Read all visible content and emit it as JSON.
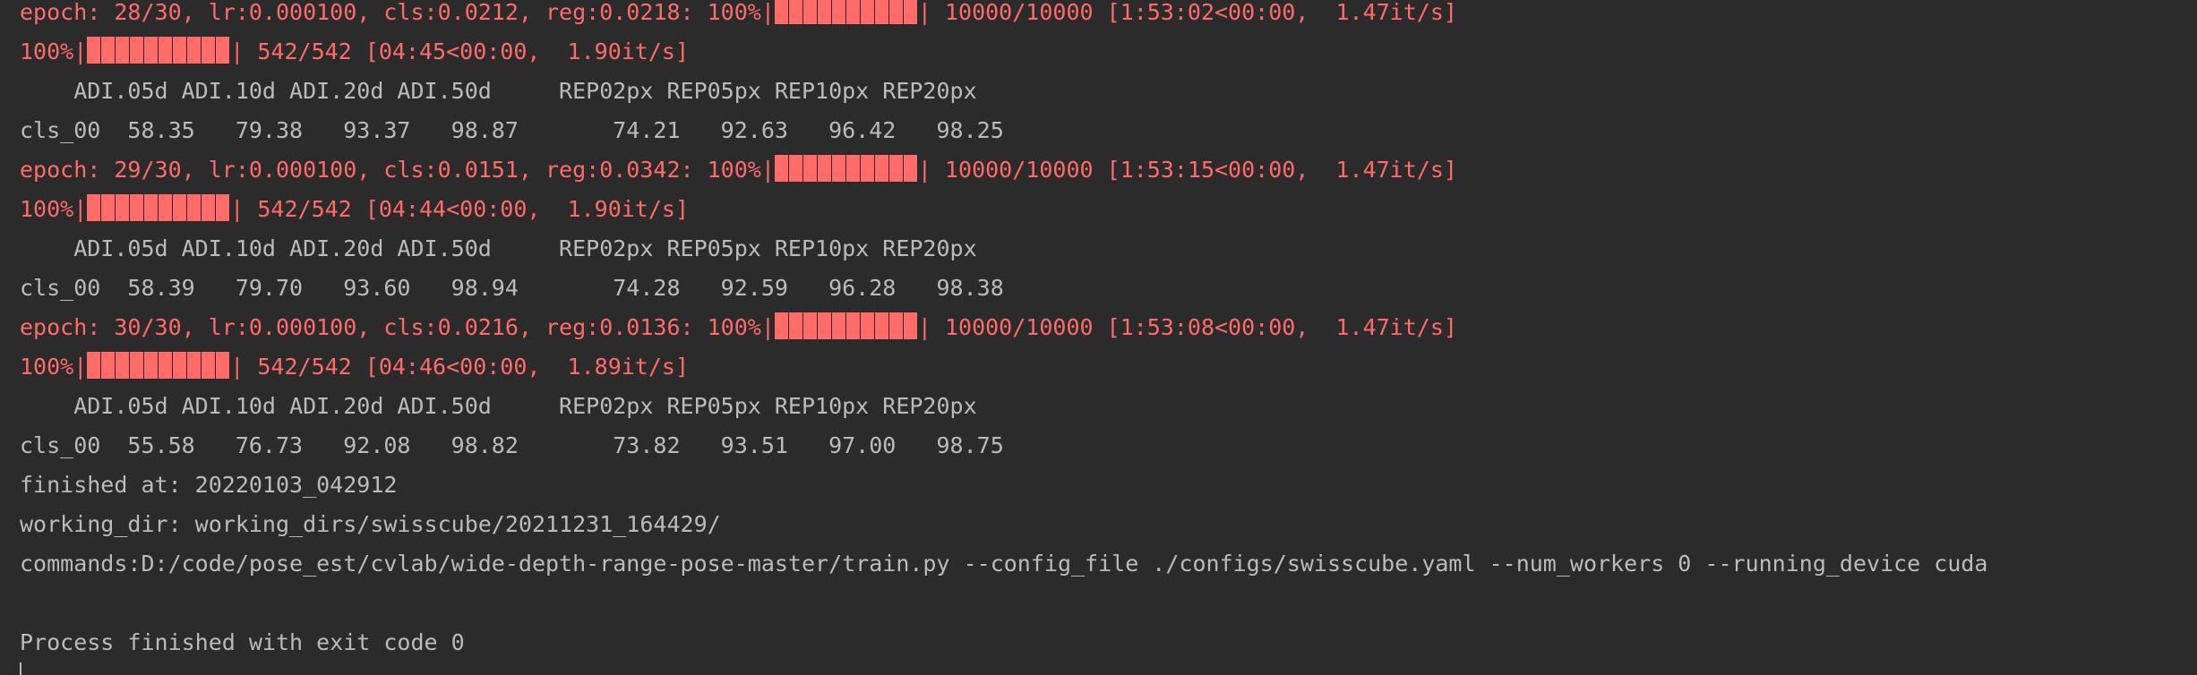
{
  "console": {
    "lines": [
      {
        "type": "progress",
        "prefix": "epoch: 28/30, lr:0.000100, cls:0.0212, reg:0.0218: 100%|",
        "suffix": "| 10000/10000 [1:53:02<00:00,  1.47it/s]",
        "progress": 1.0
      },
      {
        "type": "progress",
        "prefix": "100%|",
        "suffix": "| 542/542 [04:45<00:00,  1.90it/s]",
        "progress": 1.0
      },
      {
        "type": "text",
        "text": "    ADI.05d ADI.10d ADI.20d ADI.50d     REP02px REP05px REP10px REP20px"
      },
      {
        "type": "text",
        "text": "cls_00  58.35   79.38   93.37   98.87       74.21   92.63   96.42   98.25"
      },
      {
        "type": "progress",
        "prefix": "epoch: 29/30, lr:0.000100, cls:0.0151, reg:0.0342: 100%|",
        "suffix": "| 10000/10000 [1:53:15<00:00,  1.47it/s]",
        "progress": 1.0
      },
      {
        "type": "progress",
        "prefix": "100%|",
        "suffix": "| 542/542 [04:44<00:00,  1.90it/s]",
        "progress": 1.0
      },
      {
        "type": "text",
        "text": "    ADI.05d ADI.10d ADI.20d ADI.50d     REP02px REP05px REP10px REP20px"
      },
      {
        "type": "text",
        "text": "cls_00  58.39   79.70   93.60   98.94       74.28   92.59   96.28   98.38"
      },
      {
        "type": "progress",
        "prefix": "epoch: 30/30, lr:0.000100, cls:0.0216, reg:0.0136: 100%|",
        "suffix": "| 10000/10000 [1:53:08<00:00,  1.47it/s]",
        "progress": 1.0
      },
      {
        "type": "progress",
        "prefix": "100%|",
        "suffix": "| 542/542 [04:46<00:00,  1.89it/s]",
        "progress": 1.0
      },
      {
        "type": "text",
        "text": "    ADI.05d ADI.10d ADI.20d ADI.50d     REP02px REP05px REP10px REP20px"
      },
      {
        "type": "text",
        "text": "cls_00  55.58   76.73   92.08   98.82       73.82   93.51   97.00   98.75"
      },
      {
        "type": "text",
        "text": "finished at: 20220103_042912"
      },
      {
        "type": "text",
        "text": "working_dir: working_dirs/swisscube/20211231_164429/"
      },
      {
        "type": "text",
        "text": "commands:D:/code/pose_est/cvlab/wide-depth-range-pose-master/train.py --config_file ./configs/swisscube.yaml --num_workers 0 --running_device cuda"
      },
      {
        "type": "blank",
        "text": ""
      },
      {
        "type": "text",
        "text": "Process finished with exit code 0"
      }
    ]
  },
  "colors": {
    "background": "#2b2b2b",
    "text": "#bbbbbb",
    "stderr": "#ff6b68"
  }
}
